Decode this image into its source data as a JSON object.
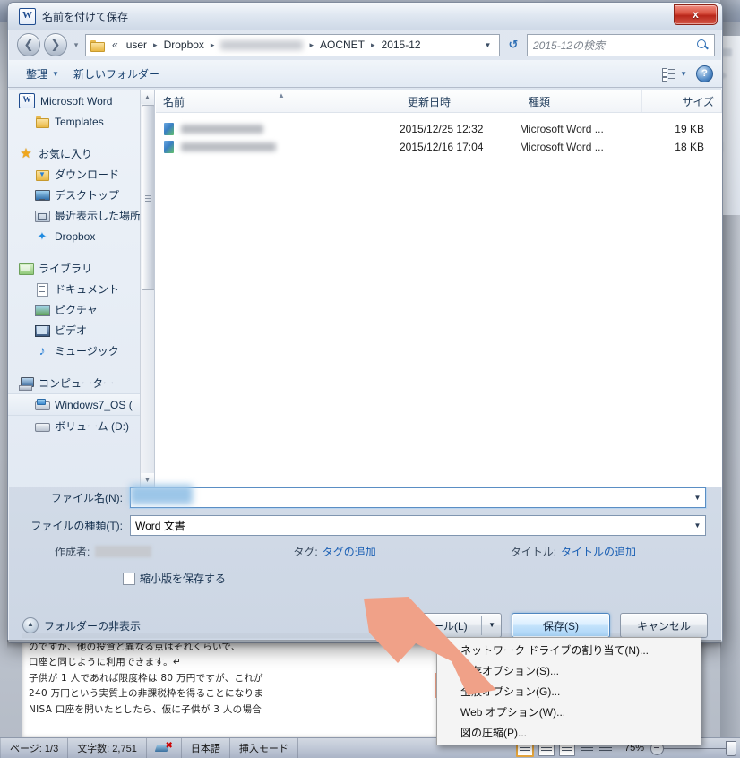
{
  "background": {
    "word_title_ghost": "",
    "document_lines": [
      "のですが、他の投資と異なる点はそれくらいで、",
      "口座と同じように利用できます。↵",
      "子供が 1 人であれば限度枠は 80 万円ですが、これが",
      "240 万円という実質上の非課税枠を得ることになりま",
      "NISA 口座を開いたとしたら、仮に子供が 3 人の場合"
    ]
  },
  "statusbar": {
    "page": "ページ: 1/3",
    "chars": "文字数: 2,751",
    "proof_icon": "spellcheck-error-icon",
    "language": "日本語",
    "insert_mode": "挿入モード",
    "view_icons": [
      "print-layout-view-icon",
      "full-screen-reading-view-icon",
      "web-layout-view-icon",
      "outline-view-icon",
      "draft-view-icon"
    ],
    "zoom": "75%",
    "zoom_out_icon": "zoom-out-icon",
    "zoom_slider_icon": "zoom-slider-thumb"
  },
  "dialog": {
    "app_icon": "word-icon",
    "app_icon_letter": "W",
    "title": "名前を付けて保存",
    "close_label": "x",
    "nav": {
      "back_icon": "back-arrow-icon",
      "forward_icon": "forward-arrow-icon",
      "history_icon": "chevron-down-icon",
      "folder_icon": "folder-icon",
      "breadcrumbs": [
        "«",
        "user",
        "Dropbox",
        "",
        "AOCNET",
        "2015-12"
      ],
      "breadcrumb_redacted_index": 3,
      "dropdown_icon": "chevron-down-icon",
      "refresh_icon": "refresh-icon",
      "search_placeholder": "2015-12の検索",
      "search_icon": "search-icon"
    },
    "toolbar": {
      "organize": "整理",
      "new_folder": "新しいフォルダー",
      "caret_icon": "chevron-down-icon",
      "view_icon": "change-view-icon",
      "view_caret_icon": "chevron-down-icon",
      "help_icon": "help-icon",
      "help_label": "?"
    },
    "sidebar": {
      "items": [
        {
          "label": "Microsoft Word",
          "icon": "word-icon",
          "indent": false,
          "selected": false,
          "gap_before": false
        },
        {
          "label": "Templates",
          "icon": "folder-icon",
          "indent": true,
          "selected": false,
          "gap_before": false
        },
        {
          "label": "お気に入り",
          "icon": "star-icon",
          "indent": false,
          "selected": false,
          "gap_before": true
        },
        {
          "label": "ダウンロード",
          "icon": "downloads-icon",
          "indent": true,
          "selected": false,
          "gap_before": false
        },
        {
          "label": "デスクトップ",
          "icon": "desktop-icon",
          "indent": true,
          "selected": false,
          "gap_before": false
        },
        {
          "label": "最近表示した場所",
          "icon": "recent-places-icon",
          "indent": true,
          "selected": false,
          "gap_before": false
        },
        {
          "label": "Dropbox",
          "icon": "dropbox-icon",
          "indent": true,
          "selected": false,
          "gap_before": false
        },
        {
          "label": "ライブラリ",
          "icon": "library-icon",
          "indent": false,
          "selected": false,
          "gap_before": true
        },
        {
          "label": "ドキュメント",
          "icon": "documents-icon",
          "indent": true,
          "selected": false,
          "gap_before": false
        },
        {
          "label": "ピクチャ",
          "icon": "pictures-icon",
          "indent": true,
          "selected": false,
          "gap_before": false
        },
        {
          "label": "ビデオ",
          "icon": "videos-icon",
          "indent": true,
          "selected": false,
          "gap_before": false
        },
        {
          "label": "ミュージック",
          "icon": "music-icon",
          "indent": true,
          "selected": false,
          "gap_before": false
        },
        {
          "label": "コンピューター",
          "icon": "computer-icon",
          "indent": false,
          "selected": false,
          "gap_before": true
        },
        {
          "label": "Windows7_OS (",
          "icon": "hard-drive-icon",
          "indent": true,
          "selected": true,
          "gap_before": false
        },
        {
          "label": "ボリューム (D:)",
          "icon": "volume-drive-icon",
          "indent": true,
          "selected": false,
          "gap_before": false
        }
      ],
      "scroll_up_icon": "scroll-up-arrow-icon",
      "scroll_down_icon": "scroll-down-arrow-icon"
    },
    "filelist": {
      "columns": [
        "名前",
        "更新日時",
        "種類",
        "サイズ"
      ],
      "sort_icon": "sort-ascending-icon",
      "rows": [
        {
          "name": "",
          "name_redacted": true,
          "icon": "word-document-icon",
          "date": "2015/12/25 12:32",
          "type": "Microsoft Word ...",
          "size": "19 KB",
          "blur_width": 92
        },
        {
          "name": "",
          "name_redacted": true,
          "icon": "word-document-icon",
          "date": "2015/12/16 17:04",
          "type": "Microsoft Word ...",
          "size": "18 KB",
          "blur_width": 106
        }
      ]
    },
    "form": {
      "filename_label": "ファイル名(N):",
      "filename_value": "",
      "filename_redacted": true,
      "filetype_label": "ファイルの種類(T):",
      "filetype_value": "Word 文書",
      "dropdown_icon": "chevron-down-icon",
      "author_label": "作成者:",
      "author_value": "",
      "author_redacted": true,
      "tags_label": "タグ:",
      "tags_link": "タグの追加",
      "title_label": "タイトル:",
      "title_link": "タイトルの追加",
      "thumbnail_checkbox_label": "縮小版を保存する",
      "thumbnail_checked": false
    },
    "footer": {
      "hide_folders_label": "フォルダーの非表示",
      "hide_folders_icon": "chevron-up-circle-icon",
      "tools_label": "ツール(L)",
      "tools_caret_icon": "chevron-down-icon",
      "save_label": "保存(S)",
      "cancel_label": "キャンセル"
    },
    "tools_menu": {
      "items": [
        {
          "label": "ネットワーク ドライブの割り当て(N)...",
          "highlighted": false
        },
        {
          "label": "保存オプション(S)...",
          "highlighted": false
        },
        {
          "label": "全般オプション(G)...",
          "highlighted": true
        },
        {
          "label": "Web オプション(W)...",
          "highlighted": false
        },
        {
          "label": "図の圧縮(P)...",
          "highlighted": false
        }
      ]
    }
  },
  "annotation": {
    "arrow_icon": "pointer-arrow-icon",
    "highlight_color": "#f0a188",
    "arrow_color": "#f0a188",
    "target": "全般オプション(G)..."
  }
}
